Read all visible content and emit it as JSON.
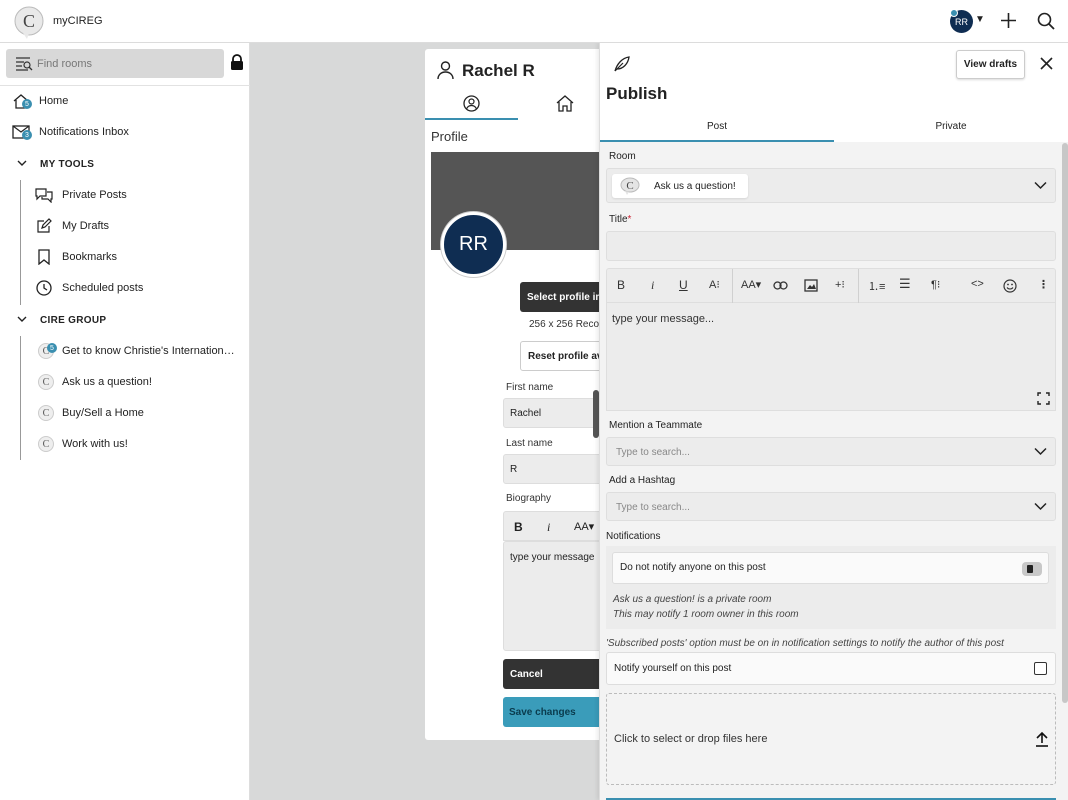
{
  "app": {
    "title": "myCIREG",
    "avatar_initials": "RR"
  },
  "sidebar": {
    "search_placeholder": "Find rooms",
    "home": {
      "label": "Home",
      "badge": "5"
    },
    "inbox": {
      "label": "Notifications Inbox",
      "badge": "3"
    },
    "my_tools": {
      "title": "MY TOOLS",
      "items": [
        "Private Posts",
        "My Drafts",
        "Bookmarks",
        "Scheduled posts"
      ]
    },
    "group": {
      "title": "CIRE GROUP",
      "rooms": [
        {
          "label": "Get to know Christie's Internation…",
          "badge": "5"
        },
        {
          "label": "Ask us a question!"
        },
        {
          "label": "Buy/Sell a Home"
        },
        {
          "label": "Work with us!"
        }
      ]
    }
  },
  "profile": {
    "name": "Rachel R",
    "section": "Profile",
    "avatar_initials": "RR",
    "select_btn": "Select profile im",
    "size_hint": "256 x 256 Recom",
    "reset_btn": "Reset profile av",
    "first_name_label": "First name",
    "first_name": "Rachel",
    "last_name_label": "Last name",
    "last_name": "R",
    "bio_label": "Biography",
    "bio_placeholder": "type your message",
    "cancel": "Cancel",
    "save": "Save changes"
  },
  "publish": {
    "title": "Publish",
    "view_drafts": "View drafts",
    "tabs": [
      "Post",
      "Private"
    ],
    "room_label": "Room",
    "room_value": "Ask us a question!",
    "title_label": "Title",
    "required_mark": "*",
    "editor_placeholder": "type your message...",
    "mention_label": "Mention a Teammate",
    "mention_placeholder": "Type to search...",
    "hashtag_label": "Add a Hashtag",
    "hashtag_placeholder": "Type to search...",
    "notifications_label": "Notifications",
    "notify_option": "Do not notify anyone on this post",
    "note1": "Ask us a question! is a private room",
    "note2": "This may notify 1 room owner in this room",
    "subscribed_note": "'Subscribed posts' option must be on in notification settings to notify the author of this post",
    "notify_self": "Notify yourself on this post",
    "drop_text": "Click to select or drop files here"
  }
}
